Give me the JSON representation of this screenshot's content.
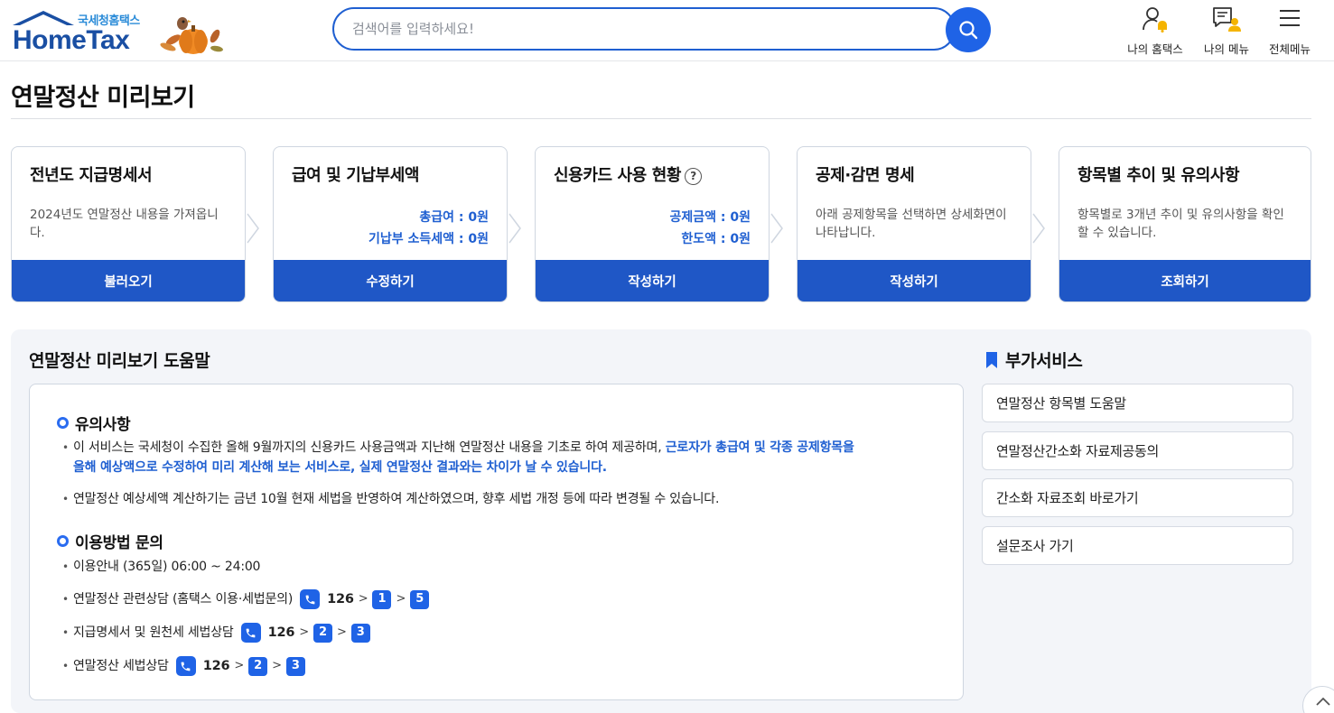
{
  "header": {
    "logo_sub": "국세청홈택스",
    "logo_text": "HomeTax",
    "search_placeholder": "검색어를 입력하세요!",
    "menus": [
      {
        "label": "나의 홈택스",
        "icon": "user-bell-icon"
      },
      {
        "label": "나의 메뉴",
        "icon": "menu-user-icon"
      },
      {
        "label": "전체메뉴",
        "icon": "hamburger-icon"
      }
    ]
  },
  "page_title": "연말정산 미리보기",
  "steps": [
    {
      "title": "전년도 지급명세서",
      "desc": "2024년도 연말정산 내용을 가져옵니다.",
      "button": "불러오기"
    },
    {
      "title": "급여 및 기납부세액",
      "values": [
        "총급여 : 0원",
        "기납부 소득세액 : 0원"
      ],
      "button": "수정하기"
    },
    {
      "title": "신용카드 사용 현황",
      "help": "?",
      "values": [
        "공제금액 : 0원",
        "한도액 : 0원"
      ],
      "button": "작성하기"
    },
    {
      "title": "공제·감면 명세",
      "desc": "아래 공제항목을 선택하면 상세화면이 나타납니다.",
      "button": "작성하기"
    },
    {
      "title": "항목별 추이 및 유의사항",
      "desc": "항목별로 3개년 추이 및 유의사항을 확인할 수 있습니다.",
      "button": "조회하기"
    }
  ],
  "help": {
    "title": "연말정산 미리보기 도움말",
    "notice_title": "유의사항",
    "notice_1a": "이 서비스는 국세청이 수집한 올해 9월까지의 신용카드 사용금액과 지난해 연말정산 내용을 기초로 하여 제공하며, ",
    "notice_1b": "근로자가 총급여 및 각종 공제항목을",
    "notice_1c": "올해 예상액으로 수정하여 미리 계산해 보는 서비스로, 실제 연말정산 결과와는 차이가 날 수 있습니다.",
    "notice_2": "연말정산 예상세액 계산하기는 금년 10월 현재 세법을 반영하여 계산하였으며, 향후 세법 개정 등에 따라 변경될 수 있습니다.",
    "contact_title": "이용방법 문의",
    "contact_hours": "이용안내 (365일) 06:00 ~ 24:00",
    "contacts": [
      {
        "label": "연말정산 관련상담 (홈택스 이용·세법문의)",
        "number": "126",
        "keys": [
          "1",
          "5"
        ]
      },
      {
        "label": "지급명세서 및 원천세 세법상담",
        "number": "126",
        "keys": [
          "2",
          "3"
        ]
      },
      {
        "label": "연말정산 세법상담",
        "number": "126",
        "keys": [
          "2",
          "3"
        ]
      }
    ],
    "gt": ">"
  },
  "side": {
    "title": "부가서비스",
    "items": [
      "연말정산 항목별 도움말",
      "연말정산간소화 자료제공동의",
      "간소화 자료조회 바로가기",
      "설문조사 가기"
    ]
  },
  "colors": {
    "primary": "#1f57c6",
    "accent": "#1f63e6",
    "highlight": "#1f5fd1"
  }
}
